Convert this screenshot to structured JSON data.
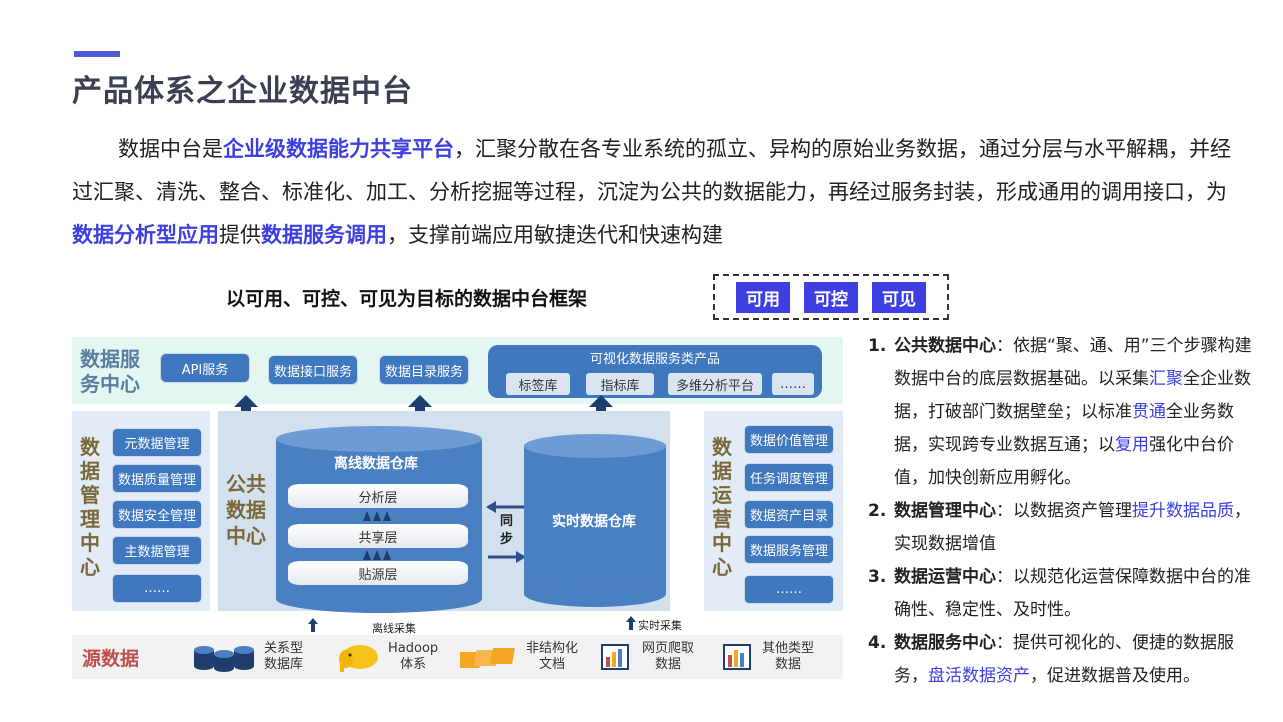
{
  "header": {
    "title": "产品体系之企业数据中台"
  },
  "intro": {
    "t1": "数据中台是",
    "h1": "企业级数据能力共享平台",
    "t2": "，汇聚分散在各专业系统的孤立、异构的原始业务数据，通过分层与水平解耦，并经过汇聚、清洗、整合、标准化、加工、分析挖掘等过程，沉淀为公共的数据能力，再经过服务封装，形成通用的调用接口，为",
    "h2": "数据分析型应用",
    "t3": "提供",
    "h3": "数据服务调用",
    "t4": "，支撑前端应用敏捷迭代和快速构建"
  },
  "framework": {
    "title": "以可用、可控、可见为目标的数据中台框架",
    "goals": [
      "可用",
      "可控",
      "可见"
    ]
  },
  "diagram": {
    "service_center": {
      "title": "数据服务中心",
      "items": [
        "API服务",
        "数据接口服务",
        "数据目录服务"
      ],
      "visual_group": {
        "title": "可视化数据服务类产品",
        "items": [
          "标签库",
          "指标库",
          "多维分析平台",
          "……"
        ]
      }
    },
    "management_center": {
      "title": "数据管理中心",
      "items": [
        "元数据管理",
        "数据质量管理",
        "数据安全管理",
        "主数据管理",
        "……"
      ]
    },
    "public_center": {
      "title": "公共数据中心",
      "offline_warehouse": "离线数据仓库",
      "layers": [
        "分析层",
        "共享层",
        "贴源层"
      ],
      "sync": "同步",
      "realtime_warehouse": "实时数据仓库"
    },
    "operations_center": {
      "title": "数据运营中心",
      "items": [
        "数据价值管理",
        "任务调度管理",
        "数据资产目录",
        "数据服务管理",
        "……"
      ]
    },
    "collection": {
      "offline": "离线采集",
      "realtime": "实时采集"
    },
    "sources": {
      "title": "源数据",
      "items": [
        {
          "line1": "关系型",
          "line2": "数据库",
          "icon": "database-icon"
        },
        {
          "line1": "Hadoop",
          "line2": "体系",
          "icon": "hadoop-elephant-icon"
        },
        {
          "line1": "非结构化",
          "line2": "文档",
          "icon": "documents-icon"
        },
        {
          "line1": "网页爬取",
          "line2": "数据",
          "icon": "web-chart-icon"
        },
        {
          "line1": "其他类型",
          "line2": "数据",
          "icon": "other-chart-icon"
        }
      ]
    }
  },
  "notes": [
    {
      "num": "1.",
      "head": "公共数据中心",
      "a": "：依据“聚、通、用”三个步骤构建数据中台的底层数据基础。以采集",
      "b1": "汇聚",
      "c": "全企业数据，打破部门数据壁垒；以标准",
      "b2": "贯通",
      "d": "全业务数据，实现跨专业数据互通；以",
      "b3": "复用",
      "e": "强化中台价值，加快创新应用孵化。"
    },
    {
      "num": "2.",
      "head": "数据管理中心",
      "a": "：以数据资产管理",
      "b1": "提升数据品质",
      "c": "，实现数据增值"
    },
    {
      "num": "3.",
      "head": "数据运营中心",
      "a": "：以规范化运营保障数据中台的准确性、稳定性、及时性。"
    },
    {
      "num": "4.",
      "head": "数据服务中心",
      "a": "：提供可视化的、便捷的数据服务，",
      "b1": "盘活数据资产",
      "c": "，促进数据普及使用。"
    }
  ],
  "colors": {
    "accent": "#4f5bd5",
    "highlight": "#3d3fe0",
    "box_blue": "#3f78bf",
    "cylinder_blue": "#4a7fc1",
    "source_title": "#c0504d"
  }
}
